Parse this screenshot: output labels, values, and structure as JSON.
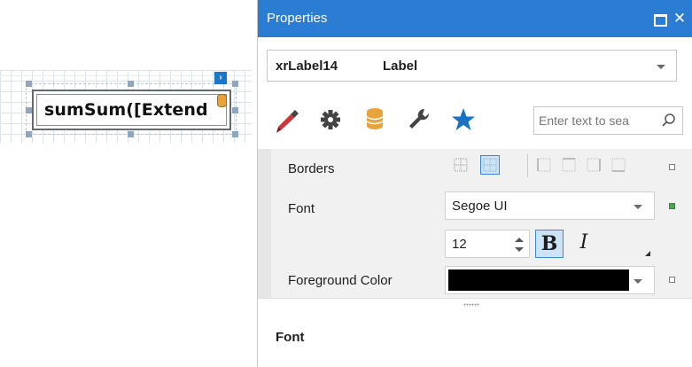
{
  "designer": {
    "label_text": "sumSum([Extend"
  },
  "properties_panel": {
    "title": "Properties",
    "object_selector": {
      "name": "xrLabel14",
      "type": "Label"
    },
    "tabs": [
      {
        "icon": "brush-icon",
        "active": true
      },
      {
        "icon": "gear-icon",
        "active": false
      },
      {
        "icon": "database-icon",
        "active": false
      },
      {
        "icon": "wrench-icon",
        "active": false
      },
      {
        "icon": "star-icon",
        "active": false
      }
    ],
    "search": {
      "placeholder": "Enter text to sea"
    },
    "properties": {
      "borders_label": "Borders",
      "font_label": "Font",
      "font_family": "Segoe UI",
      "font_size": "12",
      "bold_label": "B",
      "italic_label": "I",
      "foreground_label": "Foreground Color",
      "foreground_color": "#000000"
    },
    "description_title": "Font"
  },
  "colors": {
    "title_bar": "#2b7cd3",
    "accent": "#1b78c8",
    "star": "#1b72c2",
    "brush_red": "#d13438",
    "database": "#e8a33a"
  }
}
